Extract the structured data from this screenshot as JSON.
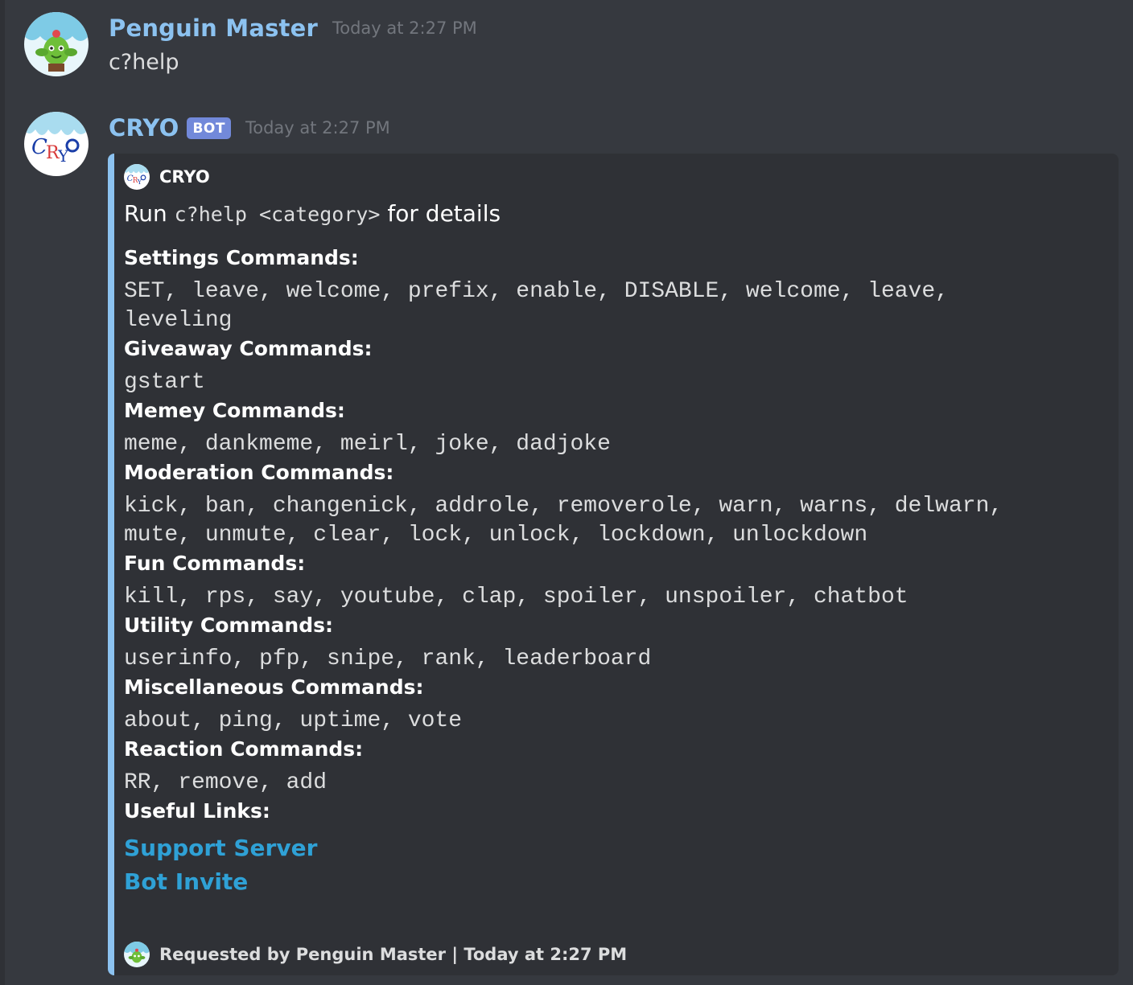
{
  "messages": [
    {
      "username": "Penguin Master",
      "timestamp": "Today at 2:27 PM",
      "content": "c?help",
      "avatar_icon": "spiky-cactus-avatar-icon"
    },
    {
      "username": "CRYO",
      "bot_tag": "BOT",
      "timestamp": "Today at 2:27 PM",
      "avatar_icon": "cryo-logo-avatar-icon"
    }
  ],
  "embed": {
    "accent_color": "#8cc2f0",
    "author": "CRYO",
    "description": {
      "prefix": "Run",
      "code": "c?help <category>",
      "suffix": "for details"
    },
    "fields": [
      {
        "name": "Settings Commands:",
        "value": "SET, leave, welcome, prefix, enable, DISABLE, welcome, leave,\nleveling"
      },
      {
        "name": "Giveaway Commands:",
        "value": "gstart"
      },
      {
        "name": "Memey Commands:",
        "value": "meme, dankmeme, meirl, joke, dadjoke"
      },
      {
        "name": "Moderation Commands:",
        "value": "kick, ban, changenick, addrole, removerole, warn, warns, delwarn,\nmute, unmute, clear, lock, unlock, lockdown, unlockdown"
      },
      {
        "name": "Fun Commands:",
        "value": "kill, rps, say, youtube, clap, spoiler, unspoiler, chatbot"
      },
      {
        "name": "Utility Commands:",
        "value": "userinfo, pfp, snipe, rank, leaderboard"
      },
      {
        "name": "Miscellaneous Commands:",
        "value": "about, ping, uptime, vote"
      },
      {
        "name": "Reaction Commands:",
        "value": "RR, remove, add"
      }
    ],
    "links_title": "Useful Links:",
    "links": [
      "Support Server",
      "Bot Invite"
    ],
    "footer": "Requested by Penguin Master | Today at 2:27 PM"
  },
  "colors": {
    "background": "#36393f",
    "embed_background": "#2f3136",
    "username": "#8cc2f0",
    "bot_tag": "#7289da",
    "link": "#2fa1d6",
    "timestamp": "#72767d"
  }
}
